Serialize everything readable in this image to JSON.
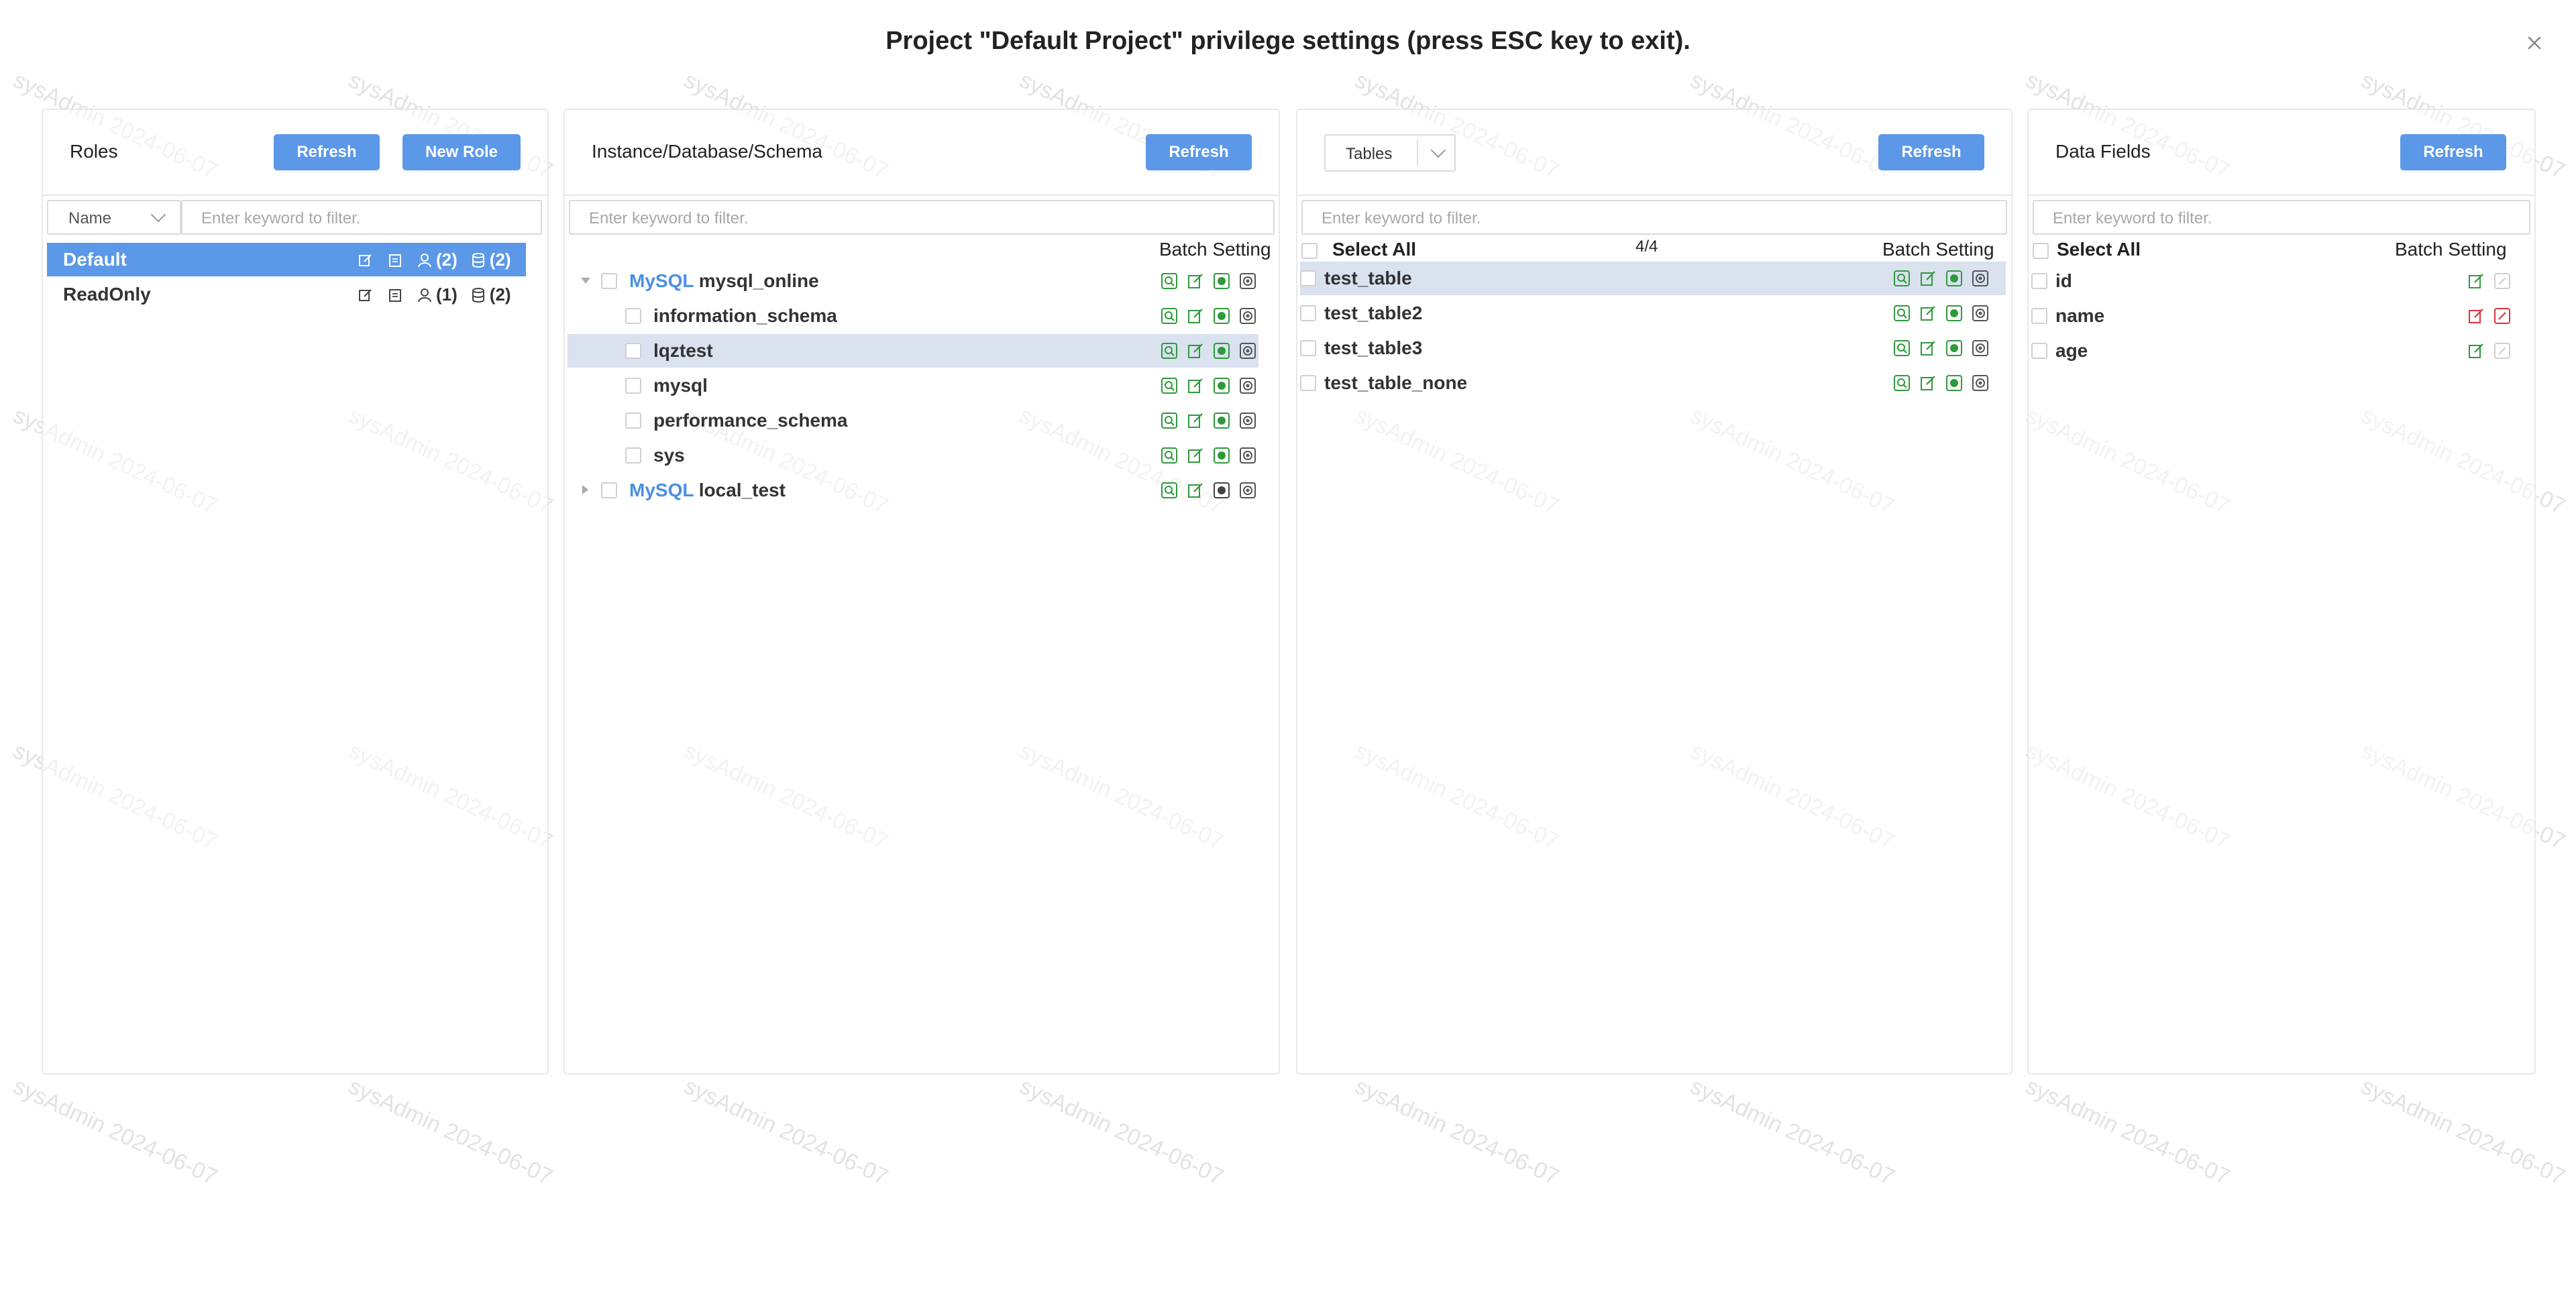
{
  "dialog": {
    "title": "Project \"Default Project\" privilege settings (press ESC key to exit).",
    "close_icon": "close-icon"
  },
  "watermark": {
    "text": "sysAdmin 2024-06-07"
  },
  "roles": {
    "title": "Roles",
    "refresh_label": "Refresh",
    "new_role_label": "New Role",
    "filter_field": "Name",
    "filter_placeholder": "Enter keyword to filter.",
    "items": [
      {
        "name": "Default",
        "users": "(2)",
        "dbs": "(2)"
      },
      {
        "name": "ReadOnly",
        "users": "(1)",
        "dbs": "(2)"
      }
    ]
  },
  "instances": {
    "title": "Instance/Database/Schema",
    "refresh_label": "Refresh",
    "filter_placeholder": "Enter keyword to filter.",
    "batch_label": "Batch Setting",
    "tree": [
      {
        "type": "MySQL",
        "name": "mysql_online",
        "expanded": true,
        "children": [
          "information_schema",
          "lqztest",
          "mysql",
          "performance_schema",
          "sys"
        ]
      },
      {
        "type": "MySQL",
        "name": "local_test",
        "expanded": false
      }
    ]
  },
  "tables": {
    "type_select": "Tables",
    "refresh_label": "Refresh",
    "filter_placeholder": "Enter keyword to filter.",
    "select_all_label": "Select All",
    "count": "4/4",
    "batch_label": "Batch Setting",
    "items": [
      "test_table",
      "test_table2",
      "test_table3",
      "test_table_none"
    ]
  },
  "fields": {
    "title": "Data Fields",
    "refresh_label": "Refresh",
    "filter_placeholder": "Enter keyword to filter.",
    "select_all_label": "Select All",
    "batch_label": "Batch Setting",
    "items": [
      {
        "name": "id",
        "status": "allowed"
      },
      {
        "name": "name",
        "status": "denied"
      },
      {
        "name": "age",
        "status": "allowed"
      }
    ]
  },
  "colors": {
    "accent": "#5b98e8",
    "selected_row": "#d9e2ee",
    "icon_green": "#2e9a3a",
    "icon_red": "#e0303a",
    "mysql_blue": "#4a8fe3"
  }
}
